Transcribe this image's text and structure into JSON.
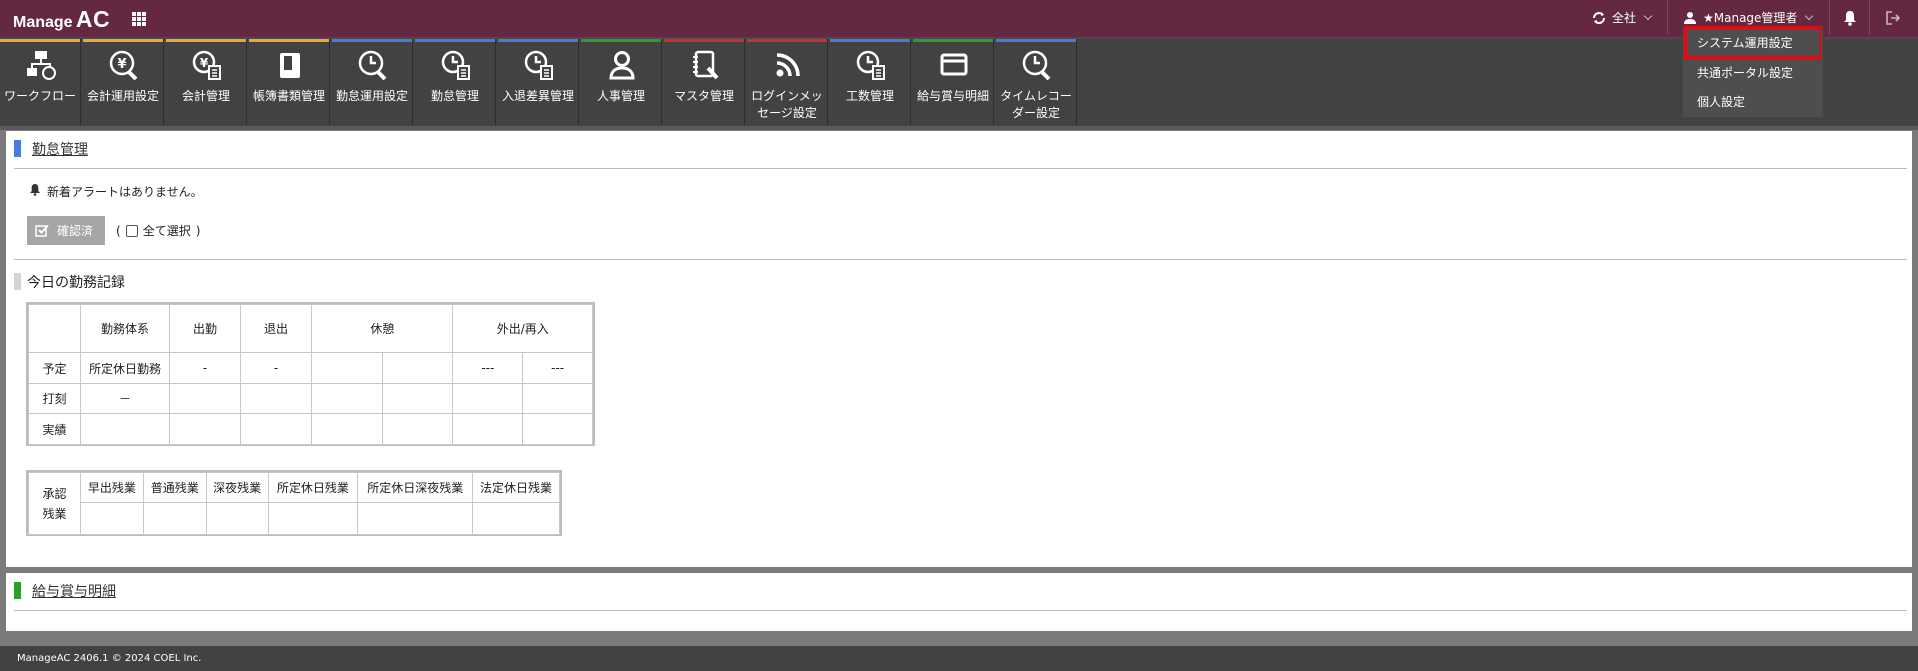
{
  "app": {
    "logo_part1": "Manage",
    "logo_part2": "AC"
  },
  "topbar": {
    "company_label": "全社",
    "user_label": "★Manage管理者"
  },
  "colors": {
    "topbar": "#652843",
    "highlight": "#d80f16",
    "orange": "#f5a623",
    "blue": "#4a7bd8",
    "green": "#2aa02a",
    "red": "#d42b2b"
  },
  "menu": [
    {
      "label": "ワークフロー",
      "icon": "workflow-icon"
    },
    {
      "label": "会計運用設定",
      "icon": "yen-wrench-icon"
    },
    {
      "label": "会計管理",
      "icon": "yen-doc-icon"
    },
    {
      "label": "帳簿書類管理",
      "icon": "book-icon"
    },
    {
      "label": "勤怠運用設定",
      "icon": "clock-wrench-icon"
    },
    {
      "label": "勤怠管理",
      "icon": "clock-doc-icon"
    },
    {
      "label": "入退差異管理",
      "icon": "clock-doc-icon"
    },
    {
      "label": "人事管理",
      "icon": "person-icon"
    },
    {
      "label": "マスタ管理",
      "icon": "notebook-wrench-icon"
    },
    {
      "label": "ログインメッ\nセージ設定",
      "icon": "rss-icon"
    },
    {
      "label": "工数管理",
      "icon": "clock-doc-icon"
    },
    {
      "label": "給与賞与明細",
      "icon": "card-icon"
    },
    {
      "label": "タイムレコー\nダー設定",
      "icon": "clock-wrench-icon"
    }
  ],
  "dropdown": {
    "items": [
      "システム運用設定",
      "共通ポータル設定",
      "個人設定"
    ]
  },
  "attendance": {
    "title": "勤怠管理",
    "alert": "新着アラートはありません。",
    "confirm_button": "確認済",
    "select_all_open": "(",
    "select_all_label": "全て選択",
    "select_all_close": ")",
    "today_title": "今日の勤務記録",
    "table": {
      "headers": [
        "勤務体系",
        "出勤",
        "退出",
        "休憩",
        "外出/再入"
      ],
      "rows": [
        {
          "label": "予定",
          "work": "所定休日勤務",
          "in": "-",
          "out": "-",
          "r1": "",
          "r2": "",
          "o1": "---",
          "o2": "---"
        },
        {
          "label": "打刻",
          "work": "－",
          "in": "",
          "out": "",
          "r1": "",
          "r2": "",
          "o1": "",
          "o2": ""
        },
        {
          "label": "実績",
          "work": "",
          "in": "",
          "out": "",
          "r1": "",
          "r2": "",
          "o1": "",
          "o2": ""
        }
      ]
    },
    "overtime": {
      "label": "承認\n残業",
      "headers": [
        "早出残業",
        "普通残業",
        "深夜残業",
        "所定休日残業",
        "所定休日深夜残業",
        "法定休日残業"
      ]
    }
  },
  "payslip": {
    "title": "給与賞与明細"
  },
  "footer": {
    "text": "ManageAC 2406.1 © 2024 COEL Inc."
  }
}
